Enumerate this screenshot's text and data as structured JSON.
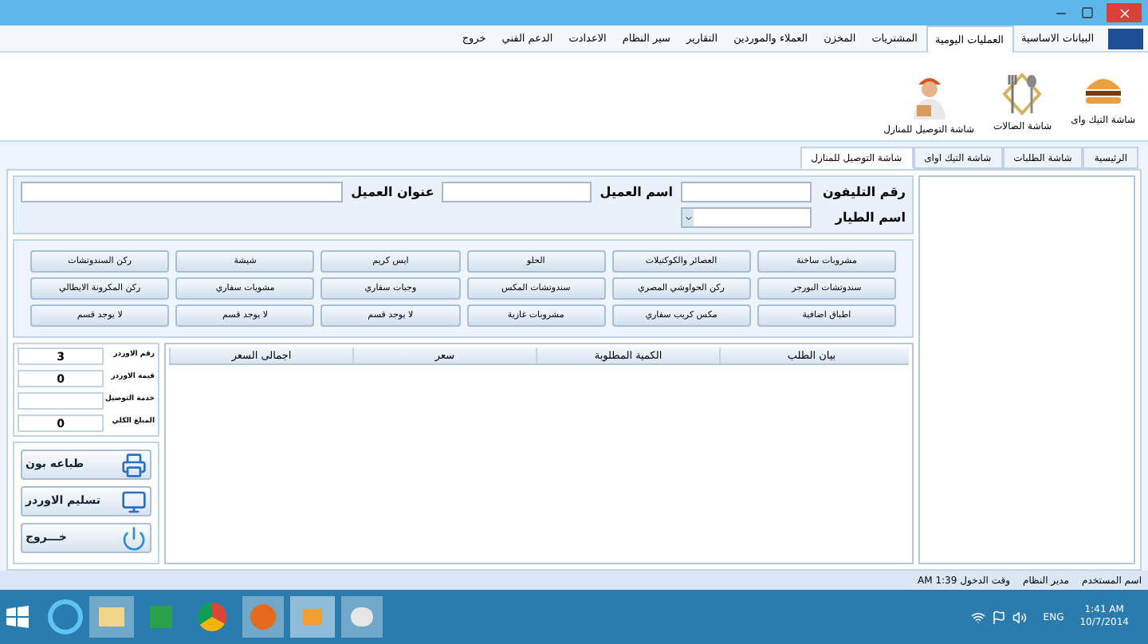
{
  "menu": [
    {
      "label": "البيانات الاساسية",
      "selected": false
    },
    {
      "label": "العمليات اليومية",
      "selected": true
    },
    {
      "label": "المشتريات",
      "selected": false
    },
    {
      "label": "المخزن",
      "selected": false
    },
    {
      "label": "العملاء والموردين",
      "selected": false
    },
    {
      "label": "التقارير",
      "selected": false
    },
    {
      "label": "سير النظام",
      "selected": false
    },
    {
      "label": "الاعدادت",
      "selected": false
    },
    {
      "label": "الدعم الفني",
      "selected": false
    },
    {
      "label": "خروج",
      "selected": false
    }
  ],
  "toolbar": [
    {
      "kind": "burger",
      "label": "شاشة التيك واى"
    },
    {
      "kind": "dining",
      "label": "شاشة الصالات"
    },
    {
      "kind": "delivery",
      "label": "شاشة التوصيل للمنازل"
    }
  ],
  "tabs": [
    {
      "label": "الرئيسية",
      "selected": false
    },
    {
      "label": "شاشة الطلبات",
      "selected": false
    },
    {
      "label": "شاشة التيك اواى",
      "selected": false
    },
    {
      "label": "شاشة التوصيل للمنازل",
      "selected": true
    }
  ],
  "form": {
    "phone_label": "رقم التليفون",
    "name_label": "اسم العميل",
    "address_label": "عنوان العميل",
    "driver_label": "اسم الطيار"
  },
  "categories": [
    "مشروبات ساخنة",
    "العصائر والكوكتيلات",
    "الحلو",
    "ايس كريم",
    "شيشة",
    "ركن السندوتشات",
    "سندوتشات البورجر",
    "ركن الحواوشي المصري",
    "سندوتشات المكس",
    "وجبات سفاري",
    "مشويات سفاري",
    "ركن المكرونة الايطالي",
    "اطباق اضافية",
    "مكس كريب سفاري",
    "مشروبات غازية",
    "لا يوجد قسم",
    "لا يوجد قسم",
    "لا يوجد قسم"
  ],
  "summary": [
    {
      "label": "رقم الاوردر",
      "value": "3"
    },
    {
      "label": "قيمة الاوردر",
      "value": "0"
    },
    {
      "label": "خدمة التوصيل"
    },
    {
      "label": "المبلغ الكلي",
      "value": "0"
    }
  ],
  "actions": [
    {
      "kind": "print",
      "label": "طباعه بون"
    },
    {
      "kind": "deliver",
      "label": "تسليم الاوردر"
    },
    {
      "kind": "exit",
      "label": "خـــروج"
    }
  ],
  "table": {
    "columns": [
      "بيان الطلب",
      "الكمية المطلوبة",
      "سعر",
      "اجمالى السعر"
    ]
  },
  "status_bar": {
    "user_label": "اسم المستخدم",
    "user": "مدير النظام",
    "login": "وقت الدخول 1:39 AM"
  },
  "taskbar": {
    "language": "ENG",
    "time": "1:41 AM",
    "date": "10/7/2014"
  }
}
